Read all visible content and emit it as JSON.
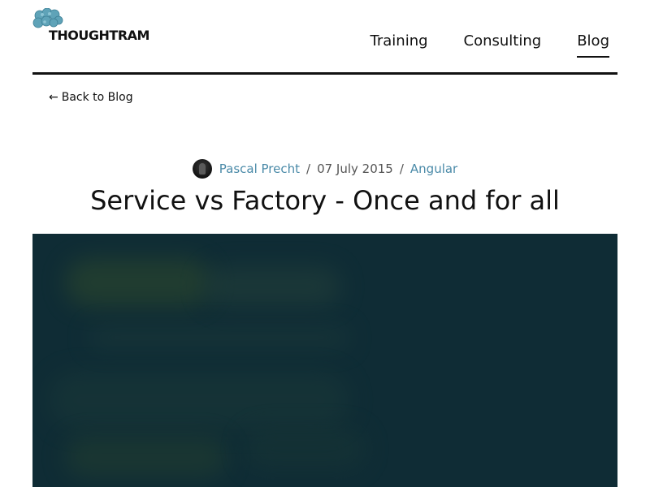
{
  "header": {
    "logo_text": "THOUGHTRAM",
    "nav": [
      {
        "label": "Training"
      },
      {
        "label": "Consulting"
      },
      {
        "label": "Blog"
      }
    ]
  },
  "back_link": {
    "arrow": "←",
    "label": "Back to Blog"
  },
  "post": {
    "author": "Pascal Precht",
    "separator": "/",
    "date": "07 July 2015",
    "category": "Angular",
    "title": "Service vs Factory - Once and for all"
  },
  "colors": {
    "accent": "#4a8aa8",
    "hero_background": "#0f2c35",
    "logo_mark": "#5fa3b8"
  },
  "icons": {
    "logo": "brain-logo-icon",
    "avatar": "author-avatar"
  }
}
